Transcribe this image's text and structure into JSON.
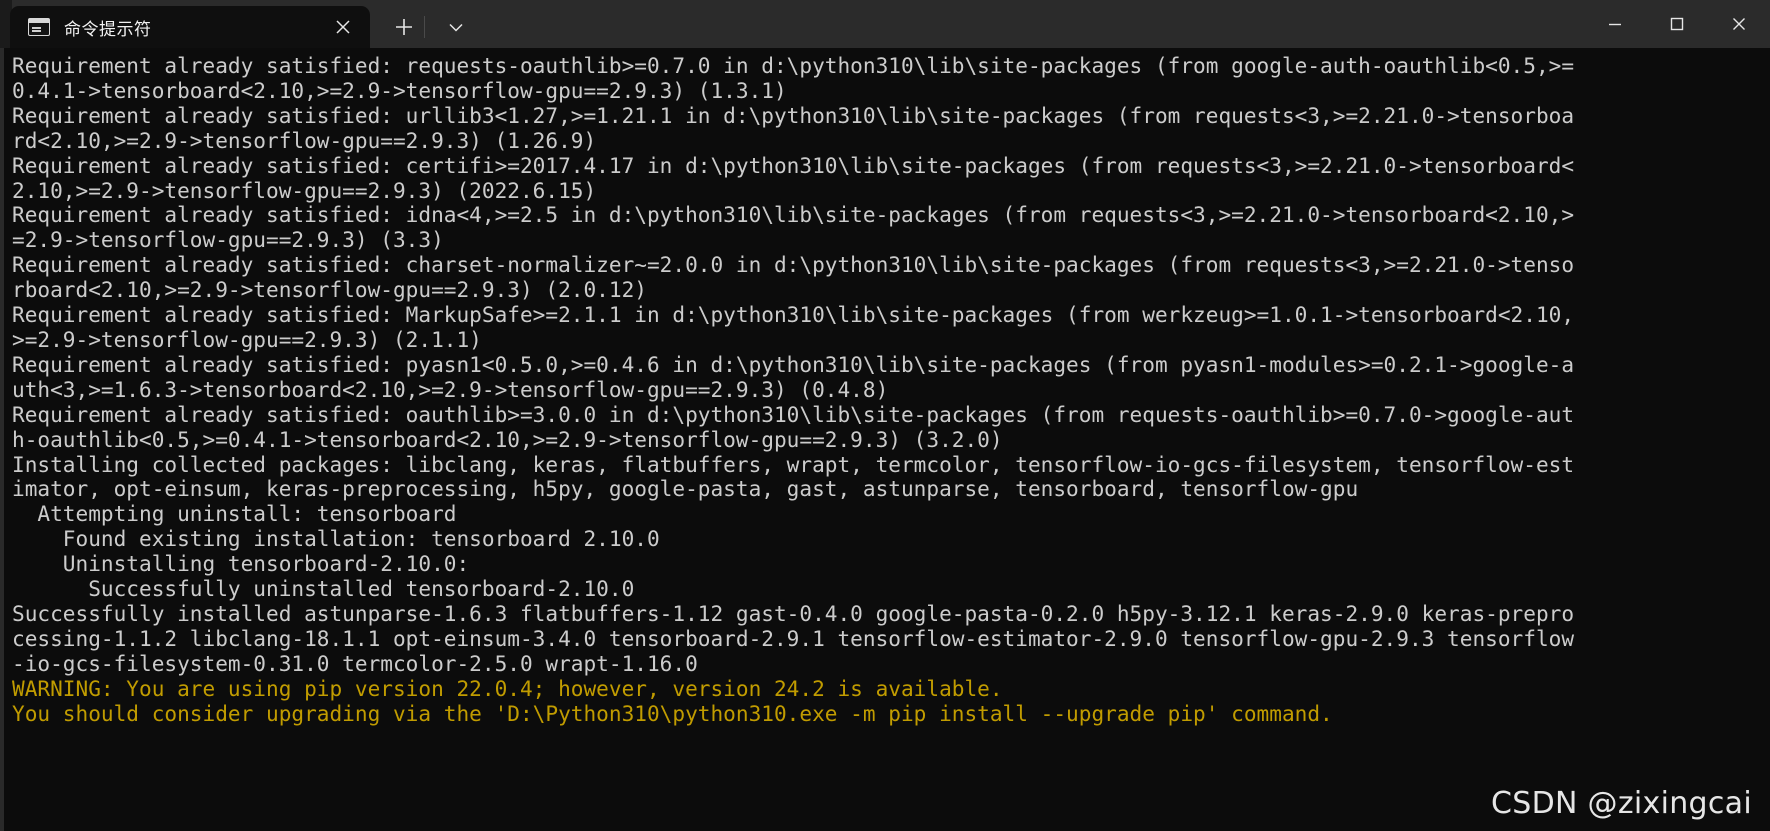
{
  "window": {
    "app": "Windows Terminal",
    "controls": {
      "minimize_label": "Minimize",
      "maximize_label": "Maximize",
      "close_label": "Close"
    }
  },
  "tabbar": {
    "tabs": [
      {
        "title": "命令提示符",
        "icon": "console-icon",
        "close_label": "×"
      }
    ],
    "new_tab_label": "+",
    "dropdown_label": "⌄"
  },
  "terminal": {
    "foreground_color": "#cccccc",
    "background_color": "#0c0c0c",
    "warning_color": "#c19c00",
    "lines": [
      {
        "text": "Requirement already satisfied: requests-oauthlib>=0.7.0 in d:\\python310\\lib\\site-packages (from google-auth-oauthlib<0.5,>=",
        "type": "normal"
      },
      {
        "text": "0.4.1->tensorboard<2.10,>=2.9->tensorflow-gpu==2.9.3) (1.3.1)",
        "type": "normal"
      },
      {
        "text": "Requirement already satisfied: urllib3<1.27,>=1.21.1 in d:\\python310\\lib\\site-packages (from requests<3,>=2.21.0->tensorboa",
        "type": "normal"
      },
      {
        "text": "rd<2.10,>=2.9->tensorflow-gpu==2.9.3) (1.26.9)",
        "type": "normal"
      },
      {
        "text": "Requirement already satisfied: certifi>=2017.4.17 in d:\\python310\\lib\\site-packages (from requests<3,>=2.21.0->tensorboard<",
        "type": "normal"
      },
      {
        "text": "2.10,>=2.9->tensorflow-gpu==2.9.3) (2022.6.15)",
        "type": "normal"
      },
      {
        "text": "Requirement already satisfied: idna<4,>=2.5 in d:\\python310\\lib\\site-packages (from requests<3,>=2.21.0->tensorboard<2.10,>",
        "type": "normal"
      },
      {
        "text": "=2.9->tensorflow-gpu==2.9.3) (3.3)",
        "type": "normal"
      },
      {
        "text": "Requirement already satisfied: charset-normalizer~=2.0.0 in d:\\python310\\lib\\site-packages (from requests<3,>=2.21.0->tenso",
        "type": "normal"
      },
      {
        "text": "rboard<2.10,>=2.9->tensorflow-gpu==2.9.3) (2.0.12)",
        "type": "normal"
      },
      {
        "text": "Requirement already satisfied: MarkupSafe>=2.1.1 in d:\\python310\\lib\\site-packages (from werkzeug>=1.0.1->tensorboard<2.10,",
        "type": "normal"
      },
      {
        "text": ">=2.9->tensorflow-gpu==2.9.3) (2.1.1)",
        "type": "normal"
      },
      {
        "text": "Requirement already satisfied: pyasn1<0.5.0,>=0.4.6 in d:\\python310\\lib\\site-packages (from pyasn1-modules>=0.2.1->google-a",
        "type": "normal"
      },
      {
        "text": "uth<3,>=1.6.3->tensorboard<2.10,>=2.9->tensorflow-gpu==2.9.3) (0.4.8)",
        "type": "normal"
      },
      {
        "text": "Requirement already satisfied: oauthlib>=3.0.0 in d:\\python310\\lib\\site-packages (from requests-oauthlib>=0.7.0->google-aut",
        "type": "normal"
      },
      {
        "text": "h-oauthlib<0.5,>=0.4.1->tensorboard<2.10,>=2.9->tensorflow-gpu==2.9.3) (3.2.0)",
        "type": "normal"
      },
      {
        "text": "Installing collected packages: libclang, keras, flatbuffers, wrapt, termcolor, tensorflow-io-gcs-filesystem, tensorflow-est",
        "type": "normal"
      },
      {
        "text": "imator, opt-einsum, keras-preprocessing, h5py, google-pasta, gast, astunparse, tensorboard, tensorflow-gpu",
        "type": "normal"
      },
      {
        "text": "  Attempting uninstall: tensorboard",
        "type": "normal"
      },
      {
        "text": "    Found existing installation: tensorboard 2.10.0",
        "type": "normal"
      },
      {
        "text": "    Uninstalling tensorboard-2.10.0:",
        "type": "normal"
      },
      {
        "text": "      Successfully uninstalled tensorboard-2.10.0",
        "type": "normal"
      },
      {
        "text": "Successfully installed astunparse-1.6.3 flatbuffers-1.12 gast-0.4.0 google-pasta-0.2.0 h5py-3.12.1 keras-2.9.0 keras-prepro",
        "type": "normal"
      },
      {
        "text": "cessing-1.1.2 libclang-18.1.1 opt-einsum-3.4.0 tensorboard-2.9.1 tensorflow-estimator-2.9.0 tensorflow-gpu-2.9.3 tensorflow",
        "type": "normal"
      },
      {
        "text": "-io-gcs-filesystem-0.31.0 termcolor-2.5.0 wrapt-1.16.0",
        "type": "normal"
      },
      {
        "text": "WARNING: You are using pip version 22.0.4; however, version 24.2 is available.",
        "type": "warn"
      },
      {
        "text": "You should consider upgrading via the 'D:\\Python310\\python310.exe -m pip install --upgrade pip' command.",
        "type": "warn"
      }
    ]
  },
  "watermark": {
    "text": "CSDN @zixingcai"
  }
}
